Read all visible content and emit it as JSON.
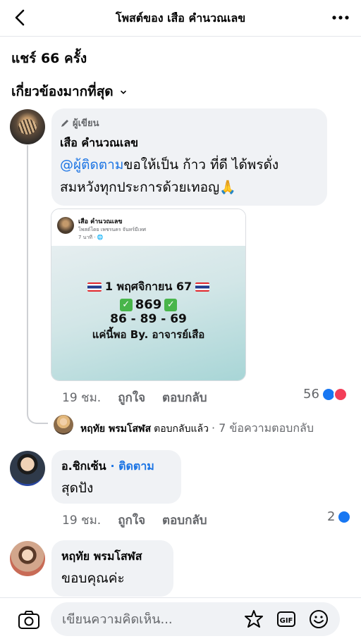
{
  "header": {
    "title": "โพสต์ของ เสือ คำนวณเลข"
  },
  "shares": "แชร์ 66 ครั้ง",
  "sort_label": "เกี่ยวข้องมากที่สุด",
  "comment1": {
    "author_tag": "ผู้เขียน",
    "name": "เสือ คำนวณเลข",
    "mention": "@ผู้ติดตาม",
    "text_line1": "ขอให้เป็น ก้าว ที่ดี ได้พรดั่ง",
    "text_line2": "สมหวังทุกประการด้วยเทอญ🙏",
    "card": {
      "name": "เสือ คำนวณเลข",
      "subtitle": "โพสต์โดย เพชรนคร จันทร์มีเทศ",
      "time": "7 นาที · 🌐",
      "line1": "1 พฤศจิกายน 67",
      "line2": "869",
      "line3": "86 - 89 - 69",
      "line4": "แค่นี้พอ By. อาจารย์เสือ"
    },
    "time": "19 ชม.",
    "like": "ถูกใจ",
    "reply": "ตอบกลับ",
    "reaction_count": "56"
  },
  "reply_summary": {
    "name": "หฤทัย พรมโสฬส",
    "action": "ตอบกลับแล้ว",
    "count": "· 7 ข้อความตอบกลับ"
  },
  "comment2": {
    "name": "อ.ชิกเซ้น",
    "follow": "· ติดตาม",
    "text": "สุดปัง",
    "time": "19 ชม.",
    "like": "ถูกใจ",
    "reply": "ตอบกลับ",
    "reaction_count": "2"
  },
  "comment3": {
    "name": "หฤทัย พรมโสฬส",
    "text": "ขอบคุณค่ะ"
  },
  "composer": {
    "placeholder": "เขียนความคิดเห็น..."
  },
  "colors": {
    "link": "#1b74e4",
    "like": "#1877f2",
    "love": "#f33e58",
    "bubble": "#f0f2f5"
  }
}
